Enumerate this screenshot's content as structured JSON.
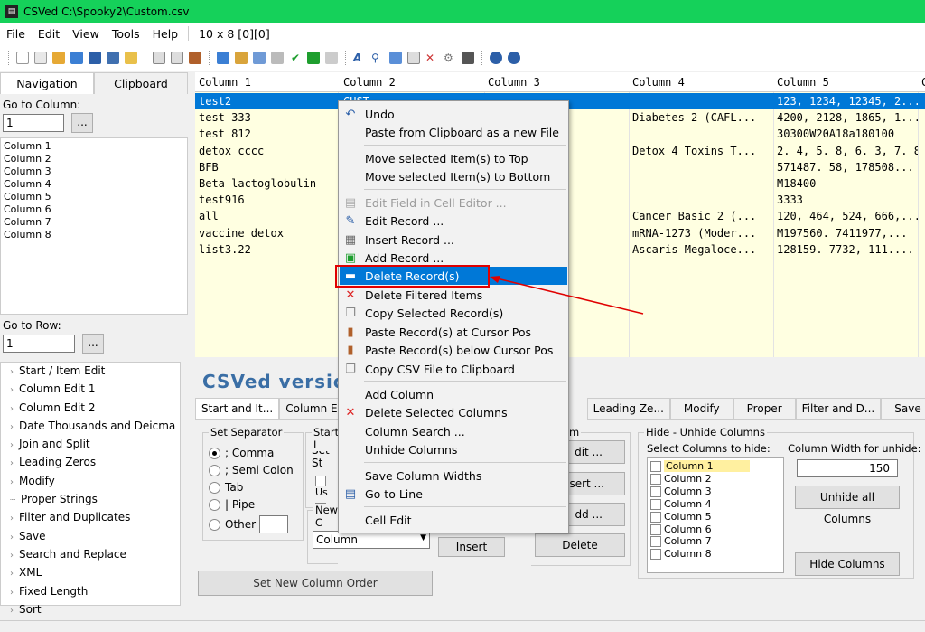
{
  "window": {
    "title": "CSVed C:\\Spooky2\\Custom.csv"
  },
  "menu": {
    "items": [
      "File",
      "Edit",
      "View",
      "Tools",
      "Help"
    ],
    "dims": "10 x 8 [0][0]"
  },
  "left": {
    "tabs": [
      "Navigation",
      "Clipboard"
    ],
    "goto_column_label": "Go to Column:",
    "goto_column_value": "1",
    "dots": "...",
    "columns": [
      "Column 1",
      "Column 2",
      "Column 3",
      "Column 4",
      "Column 5",
      "Column 6",
      "Column 7",
      "Column 8"
    ],
    "goto_row_label": "Go to Row:",
    "goto_row_value": "1",
    "tree": [
      "Start / Item Edit",
      "Column Edit 1",
      "Column Edit 2",
      "Date Thousands and Deicma",
      "Join and Split",
      "Leading Zeros",
      "Modify",
      "Proper Strings",
      "Filter and Duplicates",
      "Save",
      "Search and Replace",
      "XML",
      "Fixed Length",
      "Sort"
    ]
  },
  "grid": {
    "headers": [
      "Column 1",
      "Column 2",
      "Column 3",
      "Column 4",
      "Column 5",
      "C"
    ],
    "rows": [
      [
        "test2",
        "CUST",
        "",
        "",
        "123, 1234, 12345, 2..."
      ],
      [
        "test  333",
        "",
        "",
        "Diabetes 2 (CAFL...",
        "4200, 2128, 1865, 1..."
      ],
      [
        "test 812",
        "",
        "",
        "",
        "30300W20A18a180100"
      ],
      [
        "detox cccc",
        "",
        "",
        "Detox 4 Toxins T...",
        "2. 4, 5. 8, 6. 3, 7. 8,..."
      ],
      [
        "BFB",
        "",
        "",
        "",
        "571487. 58, 178508..."
      ],
      [
        "Beta-lactoglobulin",
        "",
        "",
        "",
        "M18400"
      ],
      [
        "test916",
        "",
        "",
        "",
        "3333"
      ],
      [
        "all",
        "",
        "",
        "Cancer Basic 2 (...",
        "120, 464, 524, 666,..."
      ],
      [
        "vaccine detox",
        "",
        "",
        "mRNA-1273 (Moder...",
        "M197560. 7411977,..."
      ],
      [
        "list3.22",
        "",
        "",
        "Ascaris Megaloce...",
        "128159. 7732, 111...."
      ]
    ]
  },
  "bottom": {
    "brand": "CSVed versio",
    "tabs": [
      "Start and It...",
      "Column Ed...",
      "Leading Ze...",
      "Modify",
      "Proper",
      "Filter and D...",
      "Save"
    ],
    "separator": {
      "title": "Set Separator",
      "options": [
        "; Comma",
        "; Semi Colon",
        "Tab",
        "| Pipe",
        "Other"
      ]
    },
    "startgrp": {
      "title": "Start I",
      "label": "Set St",
      "us1": "Us",
      "us2": "Us"
    },
    "newcol": {
      "title": "New C",
      "select": "Column",
      "insert": "Insert"
    },
    "itemgrp": {
      "title": "m",
      "edit": "dit ...",
      "insert": "sert ...",
      "add": "dd ...",
      "delete": "Delete"
    },
    "hide": {
      "title": "Hide - Unhide Columns",
      "select_label": "Select Columns to hide:",
      "width_label": "Column Width for unhide:",
      "width_value": "150",
      "unhide_all": "Unhide all Columns",
      "hide_btn": "Hide Columns",
      "cols": [
        "Column 1",
        "Column 2",
        "Column 3",
        "Column 4",
        "Column 5",
        "Column 6",
        "Column 7",
        "Column 8"
      ]
    },
    "set_order": "Set New Column Order"
  },
  "context_menu": {
    "items": [
      "Undo",
      "Paste from Clipboard as a new File",
      "Move selected Item(s) to Top",
      "Move selected Item(s) to Bottom",
      "Edit Field in Cell Editor ...",
      "Edit Record ...",
      "Insert Record ...",
      "Add Record ...",
      "Delete Record(s)",
      "Delete Filtered Items",
      "Copy Selected Record(s)",
      "Paste Record(s) at Cursor Pos",
      "Paste Record(s) below Cursor Pos",
      "Copy CSV File to Clipboard",
      "Add Column",
      "Delete Selected Columns",
      "Column Search ...",
      "Unhide Columns",
      "Save Column Widths",
      "Go to Line",
      "Cell Edit"
    ]
  },
  "colors": {
    "title_green": "#15d15a",
    "selection": "#0078d7",
    "grid_bg": "#ffffe1",
    "annotation_red": "#e00000"
  }
}
